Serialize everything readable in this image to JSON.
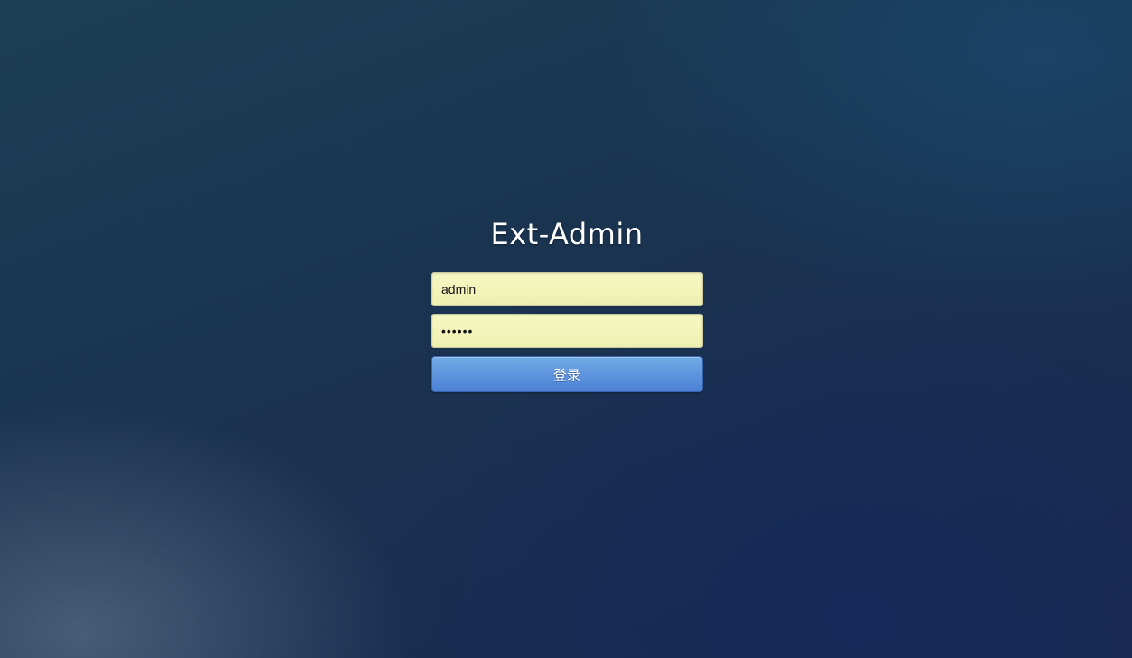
{
  "app": {
    "title": "Ext-Admin"
  },
  "login_form": {
    "username_value": "admin",
    "password_value": "123456",
    "submit_label": "登录"
  },
  "colors": {
    "button_top": "#73abe6",
    "button_bottom": "#4d80d6",
    "field_background": "#f4f6bc"
  }
}
